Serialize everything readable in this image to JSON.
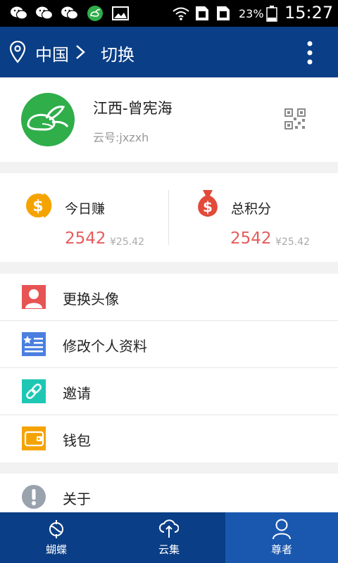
{
  "status_bar": {
    "notification_icons": [
      "wechat-icon",
      "wechat-icon",
      "wechat-icon",
      "app-icon",
      "image-icon"
    ],
    "system_icons": [
      "wifi-icon",
      "sim-card-icon",
      "sim-card-icon",
      "battery-icon"
    ],
    "battery": "23%",
    "time": "15:27"
  },
  "header": {
    "region": "中国",
    "switch_label": "切换",
    "icons": [
      "location-pin-icon",
      "chevron-right-icon",
      "more-vertical-icon"
    ]
  },
  "profile": {
    "name": "江西-曾宪海",
    "cloud_id": "云号:jxzxh",
    "icons": [
      "avatar",
      "qr-code-icon"
    ]
  },
  "stats": {
    "today": {
      "label": "今日赚",
      "value": "2542",
      "money": "¥25.42",
      "icon": "coin-icon"
    },
    "total": {
      "label": "总积分",
      "value": "2542",
      "money": "¥25.42",
      "icon": "money-bag-icon"
    }
  },
  "menu_group_1": [
    {
      "label": "更换头像",
      "icon": "portrait-icon",
      "color": "#e85353"
    },
    {
      "label": "修改个人资料",
      "icon": "profile-card-icon",
      "color": "#4a7fe0"
    },
    {
      "label": "邀请",
      "icon": "link-icon",
      "color": "#1ec7b4"
    },
    {
      "label": "钱包",
      "icon": "wallet-icon",
      "color": "#f5a300"
    }
  ],
  "menu_group_2": [
    {
      "label": "关于",
      "icon": "info-icon",
      "color": "#9aa3ad"
    }
  ],
  "bottom_nav": [
    {
      "label": "蝴蝶",
      "icon": "butterfly-icon",
      "active": false
    },
    {
      "label": "云集",
      "icon": "cloud-icon",
      "active": false
    },
    {
      "label": "尊者",
      "icon": "user-icon",
      "active": true
    }
  ],
  "colors": {
    "primary": "#0a3e86",
    "nav_active": "#1a58b0",
    "value_red": "#e65c5c",
    "avatar_green": "#2fae4a"
  }
}
